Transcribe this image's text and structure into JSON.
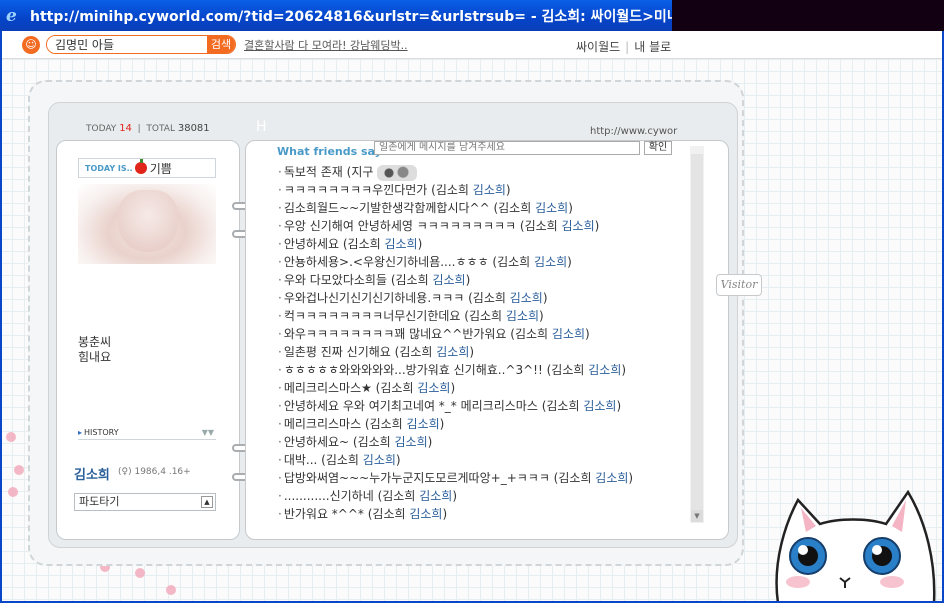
{
  "window": {
    "title": "http://minihp.cyworld.com/?tid=20624816&urlstr=&urlstrsub= - 김소희: 싸이월드>미니홈피 - W"
  },
  "toolbar": {
    "search_value": "김명민 아들",
    "search_button": "검색",
    "ad_text": "결혼할사람 다 모여라! 강남웨딩박..",
    "links": [
      "싸이월드",
      "내 블로"
    ]
  },
  "counter": {
    "today_label": "TODAY",
    "today_value": "14",
    "total_label": "TOTAL",
    "total_value": "38081",
    "h_mark": "H",
    "url": "http://www.cywor"
  },
  "profile": {
    "today_is_label": "TODAY IS..",
    "mood": "기쁨",
    "intro": "봉춘씨\n힘내요",
    "history_label": "HISTORY",
    "name": "김소희",
    "info": "(♀) 1986,4 .16+",
    "select_value": "파도타기"
  },
  "guestbook": {
    "header": "What friends say",
    "input_placeholder": "일촌에게 메시지를 남겨주세요",
    "button": "확인",
    "entries": [
      {
        "text": "독보적 존재 (지구 ",
        "nick": ""
      },
      {
        "text": "ㅋㅋㅋㅋㅋㅋㅋㅋ우낀다먼가 (김소희 ",
        "nick": "김소희",
        "close": ")"
      },
      {
        "text": "김소희월드~~기발한생각함께합시다^^ (김소희 ",
        "nick": "김소희",
        "close": ")"
      },
      {
        "text": "우앙 신기해여 안녕하세영 ㅋㅋㅋㅋㅋㅋㅋㅋㅋ (김소희 ",
        "nick": "김소희",
        "close": ")"
      },
      {
        "text": "안녕하세요 (김소희 ",
        "nick": "김소희",
        "close": ")"
      },
      {
        "text": "안뇽하세용>.<우왕신기하네욤....ㅎㅎㅎ (김소희 ",
        "nick": "김소희",
        "close": ")"
      },
      {
        "text": "우와 다모았다소희들 (김소희 ",
        "nick": "김소희",
        "close": ")"
      },
      {
        "text": "우와겁나신기신기신기하네용.ㅋㅋㅋ (김소희 ",
        "nick": "김소희",
        "close": ")"
      },
      {
        "text": "컥ㅋㅋㅋㅋㅋㅋㅋㅋ너무신기한데요 (김소희 ",
        "nick": "김소희",
        "close": ")"
      },
      {
        "text": "와우ㅋㅋㅋㅋㅋㅋㅋㅋ꽤 많네요^^반가워요 (김소희 ",
        "nick": "김소희",
        "close": ")"
      },
      {
        "text": "일촌평 진짜 신기해요 (김소희 ",
        "nick": "김소희",
        "close": ")"
      },
      {
        "text": "ㅎㅎㅎㅎㅎ와와와와와...방가워효 신기해효..^3^!! (김소희 ",
        "nick": "김소희",
        "close": ")"
      },
      {
        "text": "메리크리스마스★ (김소희 ",
        "nick": "김소희",
        "close": ")"
      },
      {
        "text": "안녕하세요 우와 여기최고네여 *_* 메리크리스마스 (김소희 ",
        "nick": "김소희",
        "close": ")"
      },
      {
        "text": "메리크리스마스 (김소희 ",
        "nick": "김소희",
        "close": ")"
      },
      {
        "text": "안녕하세요~ (김소희 ",
        "nick": "김소희",
        "close": ")"
      },
      {
        "text": "대박... (김소희 ",
        "nick": "김소희",
        "close": ")"
      },
      {
        "text": "답방와써염~~~누가누군지도모르게따앙+_+ㅋㅋㅋ (김소희 ",
        "nick": "김소희",
        "close": ")"
      },
      {
        "text": "............신기하네 (김소희 ",
        "nick": "김소희",
        "close": ")"
      },
      {
        "text": "반가워요 *^^* (김소희 ",
        "nick": "김소희",
        "close": ")"
      }
    ]
  },
  "visitor_tab": "Visitor",
  "colors": {
    "accent_orange": "#f36b21",
    "link_blue": "#2a5e9a",
    "header_blue": "#4a9ac8",
    "today_red": "#e2231a"
  }
}
